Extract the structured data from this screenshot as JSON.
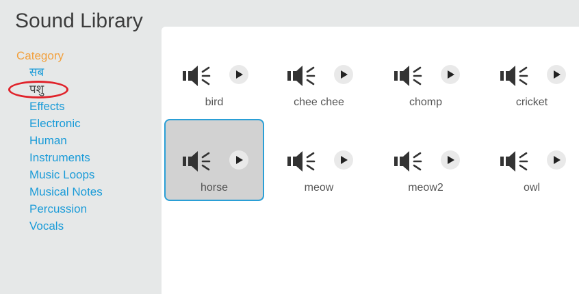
{
  "window": {
    "title": "Sound Library"
  },
  "sidebar": {
    "heading": "Category",
    "items": [
      {
        "label": "सब"
      },
      {
        "label": "पशु",
        "selected": true,
        "annotated": true
      },
      {
        "label": "Effects"
      },
      {
        "label": "Electronic"
      },
      {
        "label": "Human"
      },
      {
        "label": "Instruments"
      },
      {
        "label": "Music Loops"
      },
      {
        "label": "Musical Notes"
      },
      {
        "label": "Percussion"
      },
      {
        "label": "Vocals"
      }
    ]
  },
  "sounds": [
    {
      "label": "bird",
      "icon": "speaker-icon"
    },
    {
      "label": "chee chee",
      "icon": "speaker-icon"
    },
    {
      "label": "chomp",
      "icon": "speaker-icon"
    },
    {
      "label": "cricket",
      "icon": "speaker-icon"
    },
    {
      "label": "horse",
      "icon": "speaker-icon",
      "selected": true
    },
    {
      "label": "meow",
      "icon": "speaker-icon"
    },
    {
      "label": "meow2",
      "icon": "speaker-icon"
    },
    {
      "label": "owl",
      "icon": "speaker-icon"
    }
  ],
  "colors": {
    "accent": "#2a9fd6",
    "category_heading": "#f2a03d",
    "link": "#1a9bd8",
    "annotation": "#e0222a"
  }
}
